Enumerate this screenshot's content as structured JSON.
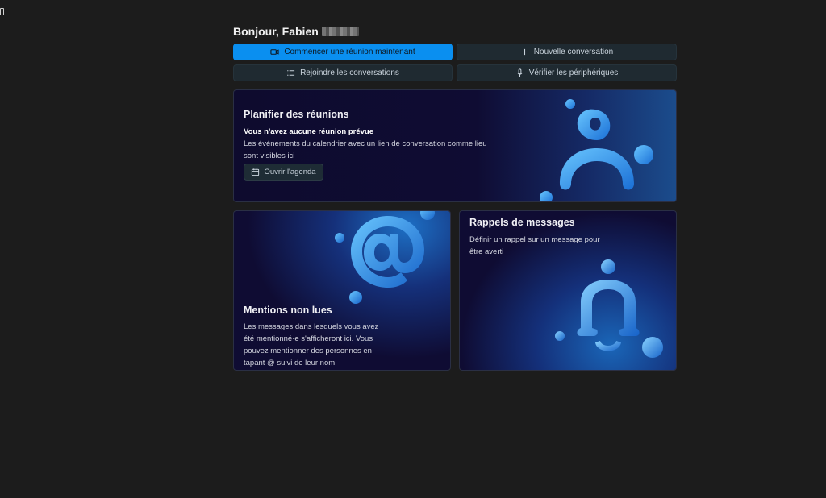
{
  "greeting": {
    "text": "Bonjour, Fabien"
  },
  "actions": {
    "start_meeting": "Commencer une réunion maintenant",
    "new_conversation": "Nouvelle conversation",
    "join_conversations": "Rejoindre les conversations",
    "check_devices": "Vérifier les périphériques"
  },
  "plan": {
    "title": "Planifier des réunions",
    "subtitle": "Vous n'avez aucune réunion prévue",
    "line1": "Les événements du calendrier avec un lien de conversation comme lieu",
    "line2": "sont visibles ici",
    "agenda_button": "Ouvrir l'agenda"
  },
  "mentions": {
    "title": "Mentions non lues",
    "line1": "Les messages dans lesquels vous avez",
    "line2": "été mentionné·e s'afficheront ici. Vous",
    "line3": "pouvez mentionner des personnes en",
    "line4": "tapant @ suivi de leur nom."
  },
  "reminders": {
    "title": "Rappels de messages",
    "line1": "Définir un rappel sur un message pour",
    "line2": "être averti"
  },
  "colors": {
    "accent": "#0a8ff0",
    "background": "#1c1c1c",
    "card_dark": "#0f0c33"
  },
  "icons": [
    "video-icon",
    "plus-icon",
    "list-icon",
    "microphone-icon",
    "calendar-icon"
  ]
}
